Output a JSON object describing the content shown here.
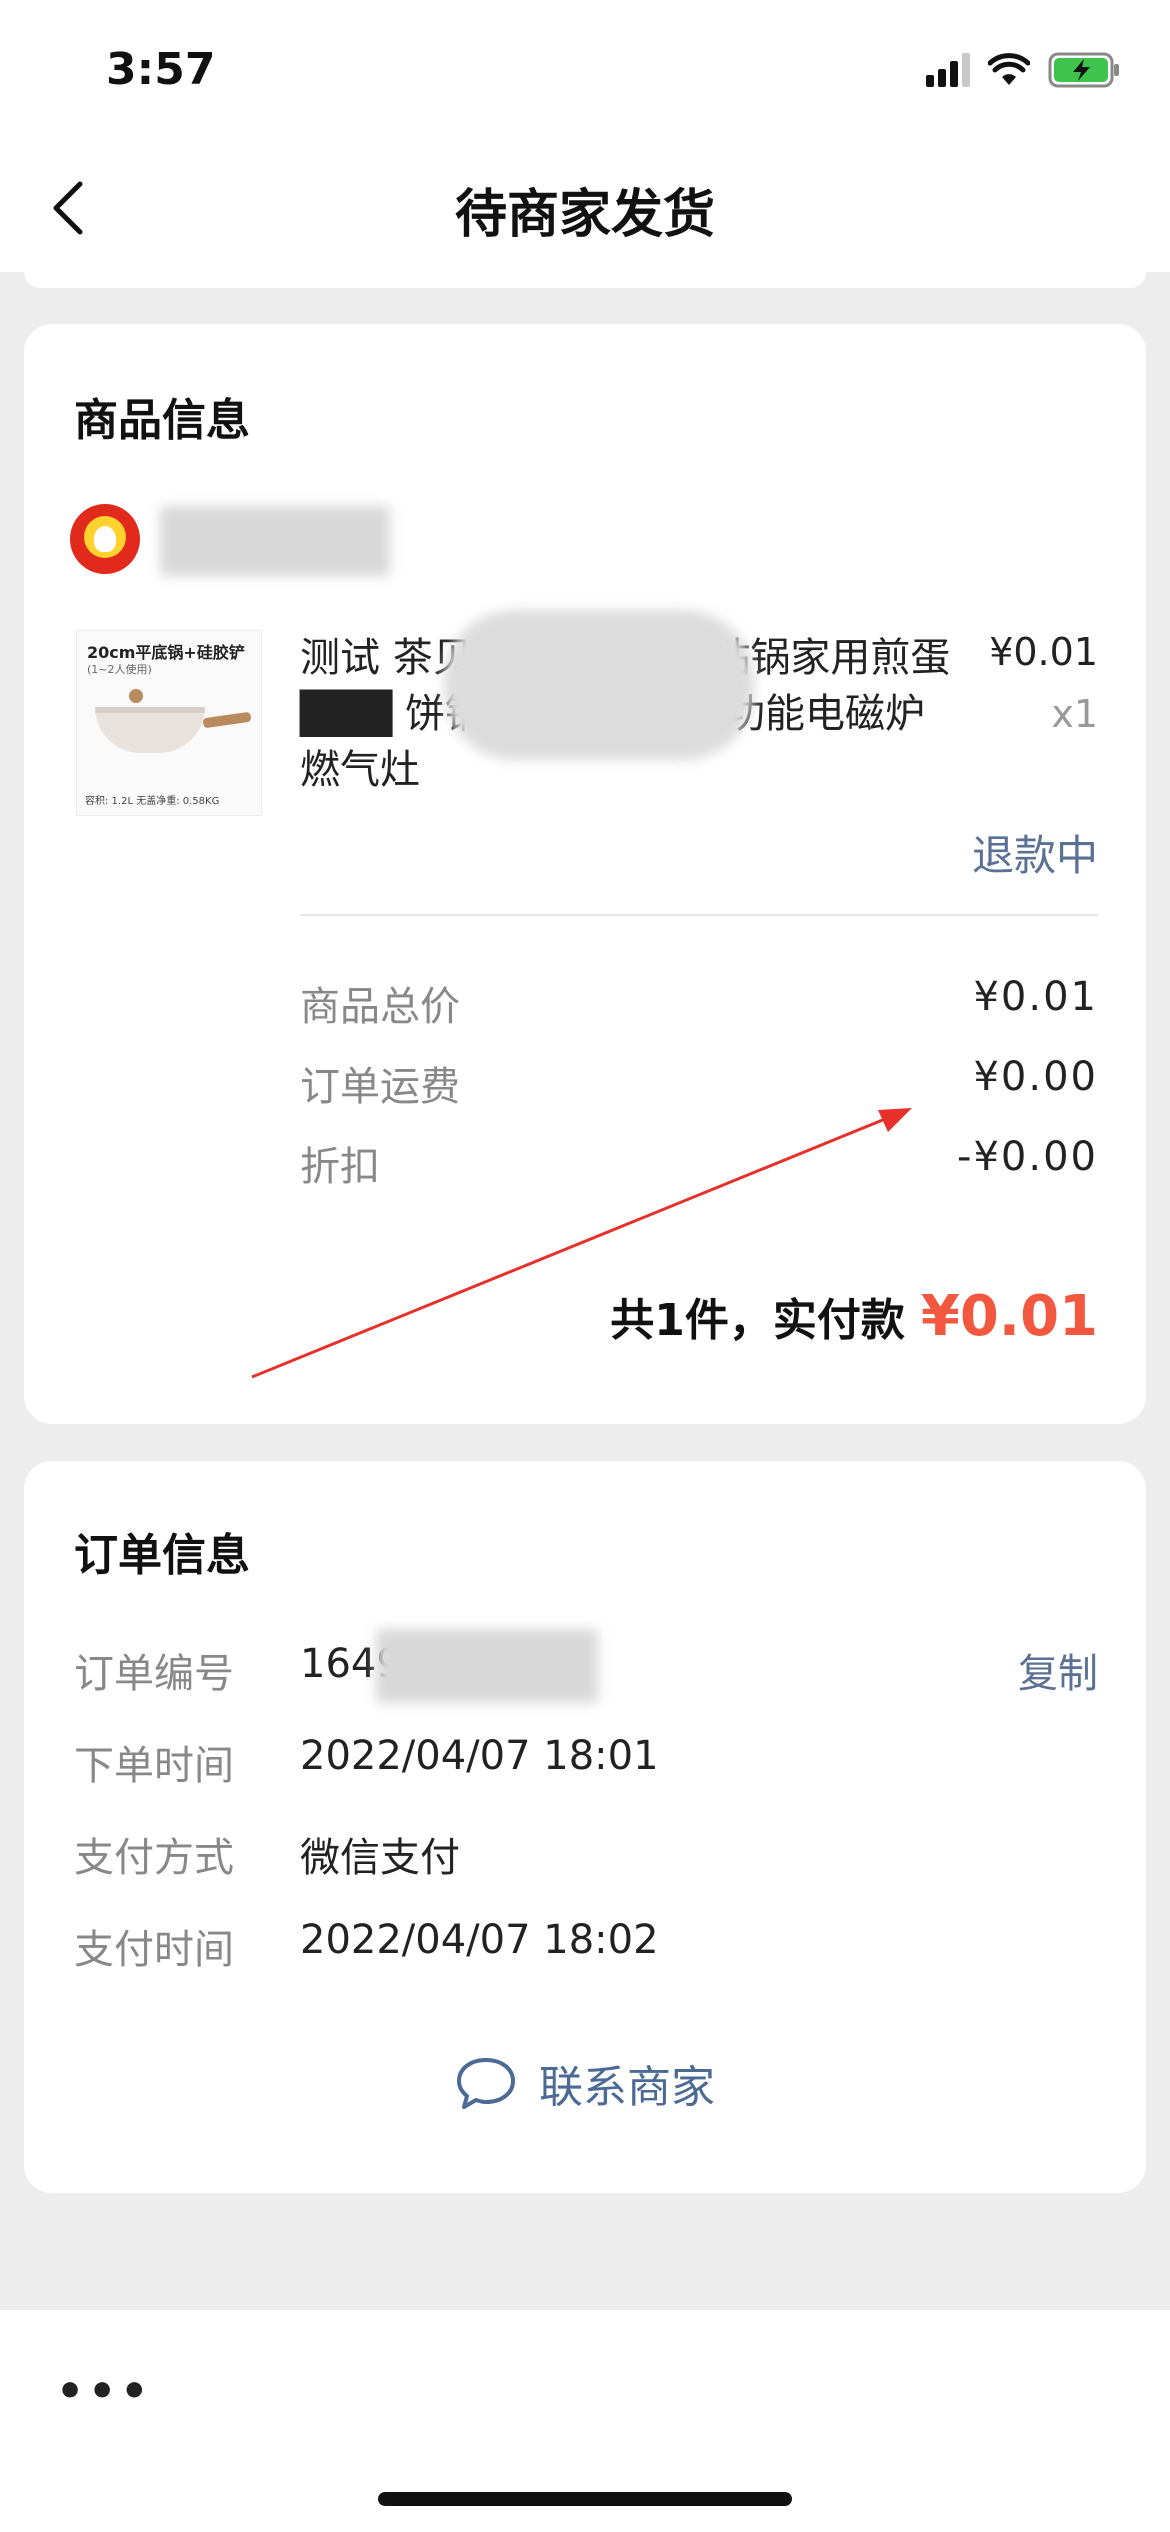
{
  "status_bar": {
    "time": "3:57"
  },
  "nav": {
    "title": "待商家发货"
  },
  "goods": {
    "section_title": "商品信息",
    "product": {
      "name": "测试 茶贝春 ███ 锅不粘锅家用煎蛋 ███ 饼锅煎锅炒菜锅多功能电磁炉燃气灶",
      "price": "¥0.01",
      "quantity": "x1",
      "status": "退款中",
      "thumb_label": "20cm平底锅+硅胶铲",
      "thumb_sub": "(1~2人使用)",
      "thumb_spec": "容积: 1.2L  无盖净重: 0.58KG"
    },
    "fees": [
      {
        "label": "商品总价",
        "value": "¥0.01"
      },
      {
        "label": "订单运费",
        "value": "¥0.00"
      },
      {
        "label": "折扣",
        "value": "-¥0.00"
      }
    ],
    "total_label": "共1件，实付款",
    "total_amount": "¥0.01"
  },
  "order": {
    "section_title": "订单信息",
    "rows": [
      {
        "label": "订单编号",
        "value": "1649         411000",
        "action": "复制"
      },
      {
        "label": "下单时间",
        "value": "2022/04/07 18:01"
      },
      {
        "label": "支付方式",
        "value": "微信支付"
      },
      {
        "label": "支付时间",
        "value": "2022/04/07 18:02"
      }
    ],
    "contact_label": "联系商家"
  },
  "bottom": {
    "more": "•••"
  },
  "colors": {
    "accent_price": "#f2583f",
    "link": "#5a7095",
    "annotation_arrow": "#e8302a"
  }
}
